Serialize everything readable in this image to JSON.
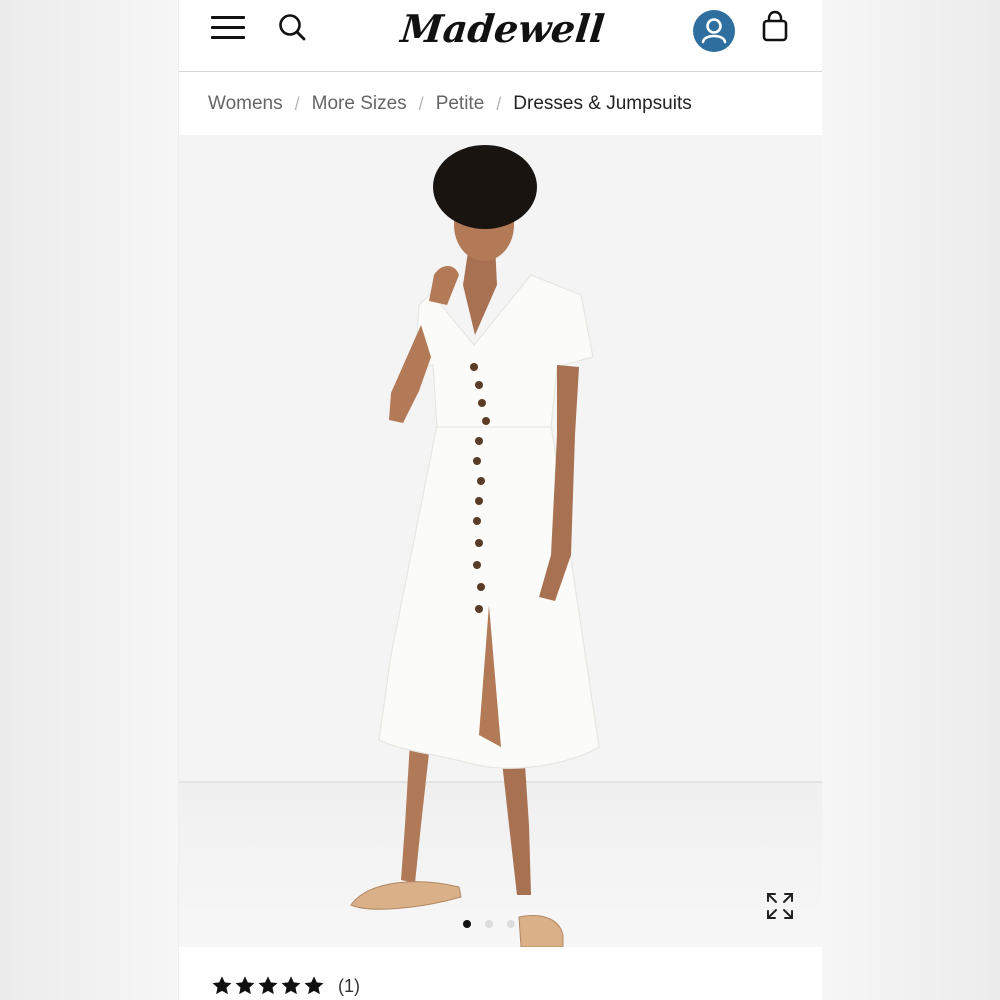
{
  "header": {
    "logo_text": "Madewell",
    "menu_icon": "hamburger-menu-icon",
    "search_icon": "search-icon",
    "account_icon": "user-account-icon",
    "bag_icon": "shopping-bag-icon",
    "account_color": "#2f6fa0"
  },
  "breadcrumb": {
    "items": [
      "Womens",
      "More Sizes",
      "Petite"
    ],
    "separator": "/",
    "current": "Dresses & Jumpsuits"
  },
  "gallery": {
    "image_description": "product-photo",
    "dot_count": 3,
    "active_dot": 0,
    "expand_icon": "expand-arrows-icon"
  },
  "rating": {
    "stars": 5,
    "count_label": "(1)"
  }
}
